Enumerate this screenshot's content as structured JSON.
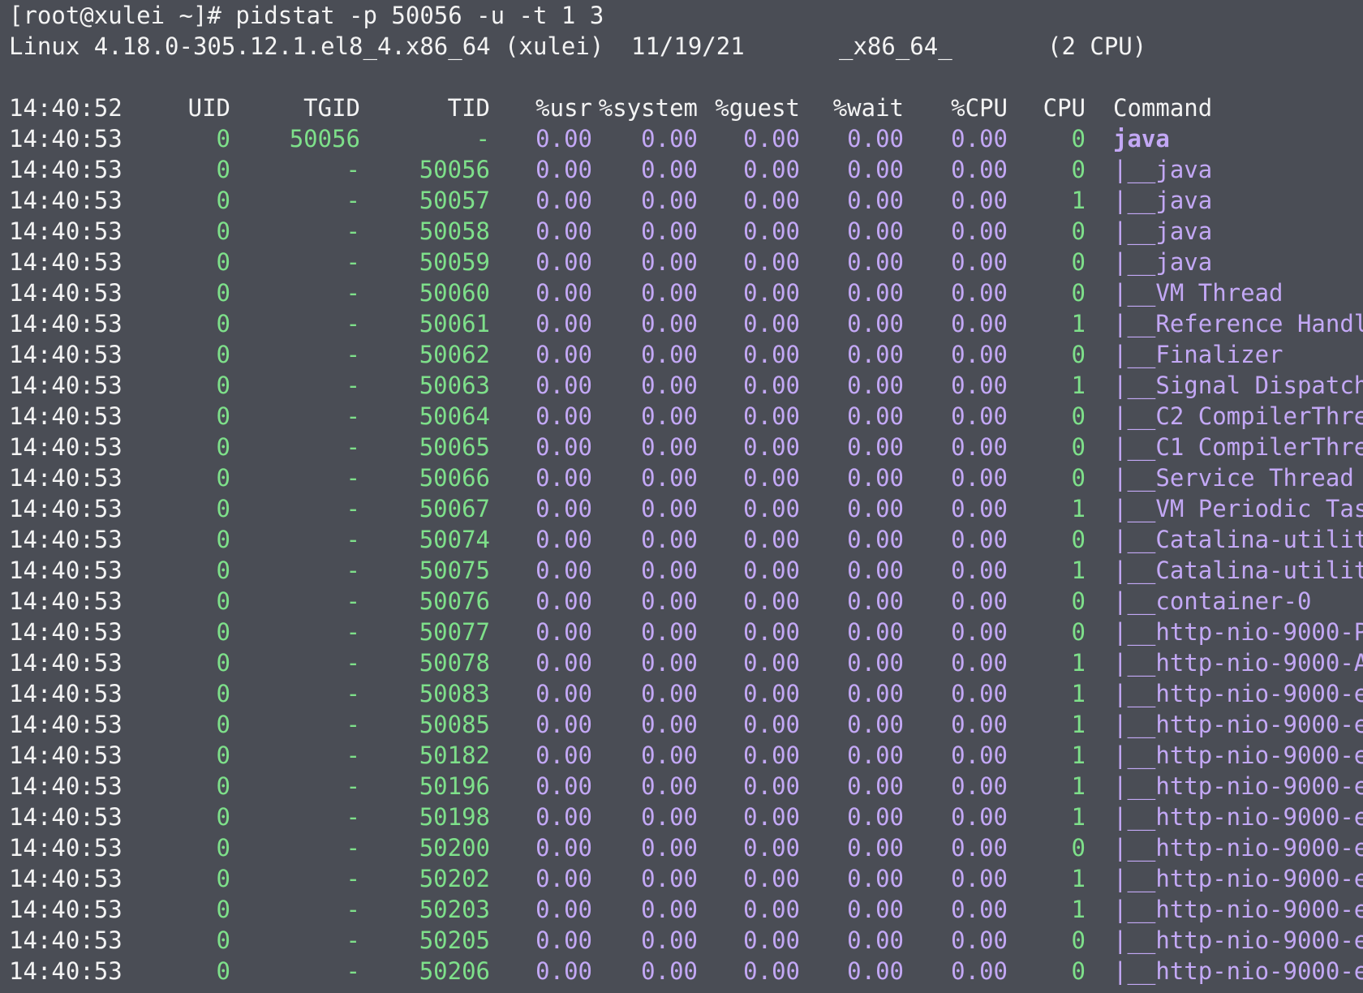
{
  "terminal": {
    "prompt": "[root@xulei ~]# pidstat -p 50056 -u -t 1 3",
    "sysinfo": {
      "kernel": "Linux 4.18.0-305.12.1.el8_4.x86_64 (xulei)",
      "date": "11/19/21",
      "arch": "_x86_64_",
      "cpus": "(2 CPU)"
    },
    "header": {
      "time": "14:40:52",
      "uid": "UID",
      "tgid": "TGID",
      "tid": "TID",
      "usr": "%usr",
      "system": "%system",
      "guest": "%guest",
      "wait": "%wait",
      "cpu_pct": "%CPU",
      "cpu": "CPU",
      "command": "Command"
    },
    "rows": [
      {
        "time": "14:40:53",
        "uid": "0",
        "tgid": "50056",
        "tid": "-",
        "usr": "0.00",
        "system": "0.00",
        "guest": "0.00",
        "wait": "0.00",
        "cpu_pct": "0.00",
        "cpu": "0",
        "command": "java"
      },
      {
        "time": "14:40:53",
        "uid": "0",
        "tgid": "-",
        "tid": "50056",
        "usr": "0.00",
        "system": "0.00",
        "guest": "0.00",
        "wait": "0.00",
        "cpu_pct": "0.00",
        "cpu": "0",
        "command": "|__java"
      },
      {
        "time": "14:40:53",
        "uid": "0",
        "tgid": "-",
        "tid": "50057",
        "usr": "0.00",
        "system": "0.00",
        "guest": "0.00",
        "wait": "0.00",
        "cpu_pct": "0.00",
        "cpu": "1",
        "command": "|__java"
      },
      {
        "time": "14:40:53",
        "uid": "0",
        "tgid": "-",
        "tid": "50058",
        "usr": "0.00",
        "system": "0.00",
        "guest": "0.00",
        "wait": "0.00",
        "cpu_pct": "0.00",
        "cpu": "0",
        "command": "|__java"
      },
      {
        "time": "14:40:53",
        "uid": "0",
        "tgid": "-",
        "tid": "50059",
        "usr": "0.00",
        "system": "0.00",
        "guest": "0.00",
        "wait": "0.00",
        "cpu_pct": "0.00",
        "cpu": "0",
        "command": "|__java"
      },
      {
        "time": "14:40:53",
        "uid": "0",
        "tgid": "-",
        "tid": "50060",
        "usr": "0.00",
        "system": "0.00",
        "guest": "0.00",
        "wait": "0.00",
        "cpu_pct": "0.00",
        "cpu": "0",
        "command": "|__VM Thread"
      },
      {
        "time": "14:40:53",
        "uid": "0",
        "tgid": "-",
        "tid": "50061",
        "usr": "0.00",
        "system": "0.00",
        "guest": "0.00",
        "wait": "0.00",
        "cpu_pct": "0.00",
        "cpu": "1",
        "command": "|__Reference Handl"
      },
      {
        "time": "14:40:53",
        "uid": "0",
        "tgid": "-",
        "tid": "50062",
        "usr": "0.00",
        "system": "0.00",
        "guest": "0.00",
        "wait": "0.00",
        "cpu_pct": "0.00",
        "cpu": "0",
        "command": "|__Finalizer"
      },
      {
        "time": "14:40:53",
        "uid": "0",
        "tgid": "-",
        "tid": "50063",
        "usr": "0.00",
        "system": "0.00",
        "guest": "0.00",
        "wait": "0.00",
        "cpu_pct": "0.00",
        "cpu": "1",
        "command": "|__Signal Dispatch"
      },
      {
        "time": "14:40:53",
        "uid": "0",
        "tgid": "-",
        "tid": "50064",
        "usr": "0.00",
        "system": "0.00",
        "guest": "0.00",
        "wait": "0.00",
        "cpu_pct": "0.00",
        "cpu": "0",
        "command": "|__C2 CompilerThre"
      },
      {
        "time": "14:40:53",
        "uid": "0",
        "tgid": "-",
        "tid": "50065",
        "usr": "0.00",
        "system": "0.00",
        "guest": "0.00",
        "wait": "0.00",
        "cpu_pct": "0.00",
        "cpu": "0",
        "command": "|__C1 CompilerThre"
      },
      {
        "time": "14:40:53",
        "uid": "0",
        "tgid": "-",
        "tid": "50066",
        "usr": "0.00",
        "system": "0.00",
        "guest": "0.00",
        "wait": "0.00",
        "cpu_pct": "0.00",
        "cpu": "0",
        "command": "|__Service Thread"
      },
      {
        "time": "14:40:53",
        "uid": "0",
        "tgid": "-",
        "tid": "50067",
        "usr": "0.00",
        "system": "0.00",
        "guest": "0.00",
        "wait": "0.00",
        "cpu_pct": "0.00",
        "cpu": "1",
        "command": "|__VM Periodic Tas"
      },
      {
        "time": "14:40:53",
        "uid": "0",
        "tgid": "-",
        "tid": "50074",
        "usr": "0.00",
        "system": "0.00",
        "guest": "0.00",
        "wait": "0.00",
        "cpu_pct": "0.00",
        "cpu": "0",
        "command": "|__Catalina-utilit"
      },
      {
        "time": "14:40:53",
        "uid": "0",
        "tgid": "-",
        "tid": "50075",
        "usr": "0.00",
        "system": "0.00",
        "guest": "0.00",
        "wait": "0.00",
        "cpu_pct": "0.00",
        "cpu": "1",
        "command": "|__Catalina-utilit"
      },
      {
        "time": "14:40:53",
        "uid": "0",
        "tgid": "-",
        "tid": "50076",
        "usr": "0.00",
        "system": "0.00",
        "guest": "0.00",
        "wait": "0.00",
        "cpu_pct": "0.00",
        "cpu": "0",
        "command": "|__container-0"
      },
      {
        "time": "14:40:53",
        "uid": "0",
        "tgid": "-",
        "tid": "50077",
        "usr": "0.00",
        "system": "0.00",
        "guest": "0.00",
        "wait": "0.00",
        "cpu_pct": "0.00",
        "cpu": "0",
        "command": "|__http-nio-9000-P"
      },
      {
        "time": "14:40:53",
        "uid": "0",
        "tgid": "-",
        "tid": "50078",
        "usr": "0.00",
        "system": "0.00",
        "guest": "0.00",
        "wait": "0.00",
        "cpu_pct": "0.00",
        "cpu": "1",
        "command": "|__http-nio-9000-A"
      },
      {
        "time": "14:40:53",
        "uid": "0",
        "tgid": "-",
        "tid": "50083",
        "usr": "0.00",
        "system": "0.00",
        "guest": "0.00",
        "wait": "0.00",
        "cpu_pct": "0.00",
        "cpu": "1",
        "command": "|__http-nio-9000-e"
      },
      {
        "time": "14:40:53",
        "uid": "0",
        "tgid": "-",
        "tid": "50085",
        "usr": "0.00",
        "system": "0.00",
        "guest": "0.00",
        "wait": "0.00",
        "cpu_pct": "0.00",
        "cpu": "1",
        "command": "|__http-nio-9000-e"
      },
      {
        "time": "14:40:53",
        "uid": "0",
        "tgid": "-",
        "tid": "50182",
        "usr": "0.00",
        "system": "0.00",
        "guest": "0.00",
        "wait": "0.00",
        "cpu_pct": "0.00",
        "cpu": "1",
        "command": "|__http-nio-9000-e"
      },
      {
        "time": "14:40:53",
        "uid": "0",
        "tgid": "-",
        "tid": "50196",
        "usr": "0.00",
        "system": "0.00",
        "guest": "0.00",
        "wait": "0.00",
        "cpu_pct": "0.00",
        "cpu": "1",
        "command": "|__http-nio-9000-e"
      },
      {
        "time": "14:40:53",
        "uid": "0",
        "tgid": "-",
        "tid": "50198",
        "usr": "0.00",
        "system": "0.00",
        "guest": "0.00",
        "wait": "0.00",
        "cpu_pct": "0.00",
        "cpu": "1",
        "command": "|__http-nio-9000-e"
      },
      {
        "time": "14:40:53",
        "uid": "0",
        "tgid": "-",
        "tid": "50200",
        "usr": "0.00",
        "system": "0.00",
        "guest": "0.00",
        "wait": "0.00",
        "cpu_pct": "0.00",
        "cpu": "0",
        "command": "|__http-nio-9000-e"
      },
      {
        "time": "14:40:53",
        "uid": "0",
        "tgid": "-",
        "tid": "50202",
        "usr": "0.00",
        "system": "0.00",
        "guest": "0.00",
        "wait": "0.00",
        "cpu_pct": "0.00",
        "cpu": "1",
        "command": "|__http-nio-9000-e"
      },
      {
        "time": "14:40:53",
        "uid": "0",
        "tgid": "-",
        "tid": "50203",
        "usr": "0.00",
        "system": "0.00",
        "guest": "0.00",
        "wait": "0.00",
        "cpu_pct": "0.00",
        "cpu": "1",
        "command": "|__http-nio-9000-e"
      },
      {
        "time": "14:40:53",
        "uid": "0",
        "tgid": "-",
        "tid": "50205",
        "usr": "0.00",
        "system": "0.00",
        "guest": "0.00",
        "wait": "0.00",
        "cpu_pct": "0.00",
        "cpu": "0",
        "command": "|__http-nio-9000-e"
      },
      {
        "time": "14:40:53",
        "uid": "0",
        "tgid": "-",
        "tid": "50206",
        "usr": "0.00",
        "system": "0.00",
        "guest": "0.00",
        "wait": "0.00",
        "cpu_pct": "0.00",
        "cpu": "0",
        "command": "|__http-nio-9000-e"
      }
    ]
  },
  "colors": {
    "background": "#4a4d55",
    "text": "#f3f3f3",
    "green": "#7ee08a",
    "purple": "#c3a8f5"
  }
}
